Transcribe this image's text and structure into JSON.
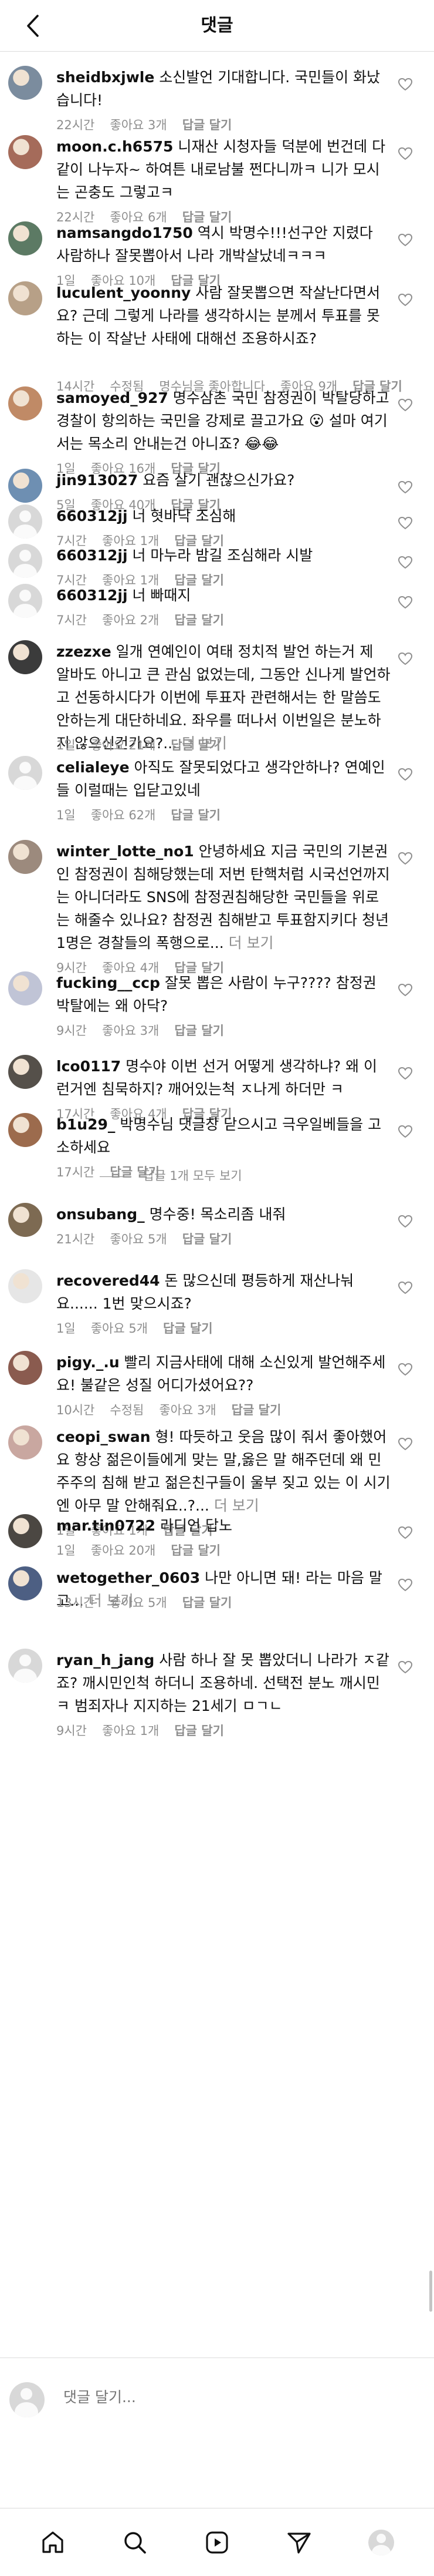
{
  "header": {
    "title": "댓글",
    "back_icon": "back-arrow-icon"
  },
  "colors": {
    "text": "#111111",
    "muted": "#8e8e8e",
    "divider": "#dbdbdb",
    "background": "#ffffff"
  },
  "comments": [
    {
      "username": "sheidbxjwle",
      "text": "소신발언 기대합니다. 국민들이 화났습니다!",
      "time": "22시간",
      "likes": "좋아요 3개",
      "reply": "답글 달기",
      "avatar": "photo"
    },
    {
      "username": "moon.c.h6575",
      "text": "니재산 시청자들 덕분에 번건데 다같이 나누자~ 하여튼 내로남불 쩐다니까ㅋ 니가 모시는 곤충도 그렇고ㅋ",
      "time": "22시간",
      "likes": "좋아요 6개",
      "reply": "답글 달기",
      "avatar": "photo"
    },
    {
      "username": "namsangdo1750",
      "text": "역시 박명수!!!선구안 지렸다 사람하나 잘못뽑아서 나라 개박살났네ㅋㅋㅋ",
      "time": "1일",
      "likes": "좋아요 10개",
      "reply": "답글 달기",
      "avatar": "photo"
    },
    {
      "username": "luculent_yoonny",
      "text": "사람 잘못뽑으면 작살난다면서요? 근데 그렇게 나라를 생각하시는 분께서 투표를 못하는 이 작살난 사태에 대해선 조용하시죠?",
      "time": "14시간",
      "edited": "수정됨",
      "likes": "명수님을 좋아합니다",
      "likes2": "좋아요 9개",
      "reply": "답글 달기",
      "avatar": "photo"
    },
    {
      "username": "samoyed_927",
      "text": "명수삼촌 국민 참정권이 박탈당하고 경찰이 항의하는 국민을 강제로 끌고가요 😮 설마 여기서는 목소리 안내는건 아니죠? 😂😂",
      "time": "1일",
      "likes": "좋아요 16개",
      "reply": "답글 달기",
      "avatar": "photo"
    },
    {
      "username": "jin913027",
      "text": "요즘 살기 괜찮으신가요?",
      "time": "5일",
      "likes": "좋아요 40개",
      "reply": "답글 달기",
      "avatar": "photo"
    },
    {
      "username": "660312jj",
      "text": "너 혓바닥 조심해",
      "time": "7시간",
      "likes": "좋아요 1개",
      "reply": "답글 달기",
      "avatar": "default"
    },
    {
      "username": "660312jj",
      "text": "너 마누라 밤길 조심해라 시발",
      "time": "7시간",
      "likes": "좋아요 1개",
      "reply": "답글 달기",
      "avatar": "default"
    },
    {
      "username": "660312jj",
      "text": "너 빠때지",
      "time": "7시간",
      "likes": "좋아요 2개",
      "reply": "답글 달기",
      "avatar": "default"
    },
    {
      "username": "zzezxe",
      "text": "일개 연예인이 여태 정치적 발언 하는거 제 알바도 아니고 큰 관심 없었는데, 그동안 신나게 발언하고 선동하시다가 이번에 투표자 관련해서는 한 말씀도 안하는게 대단하네요. 좌우를 떠나서 이번일은 분노하지 않으신건가요?...",
      "more": "더 보기",
      "time": "1일",
      "likes": "좋아요 21개",
      "reply": "답글 달기",
      "avatar": "photo"
    },
    {
      "username": "celialeye",
      "text": "아직도 잘못되었다고 생각안하나? 연예인들 이럴때는 입닫고있네",
      "time": "1일",
      "likes": "좋아요 62개",
      "reply": "답글 달기",
      "avatar": "default"
    },
    {
      "username": "winter_lotte_no1",
      "text": "안녕하세요 지금 국민의 기본권인 참정권이 침해당했는데 저번 탄핵처럼 시국선언까지는 아니더라도 SNS에 참정권침해당한 국민들을 위로는 해줄수 있나요? 참정권 침해받고 투표함지키다 청년1명은 경찰들의 폭행으로...",
      "more": "더 보기",
      "time": "9시간",
      "likes": "좋아요 4개",
      "reply": "답글 달기",
      "avatar": "photo"
    },
    {
      "username": "fucking__ccp",
      "text": "잘못 뽑은 사람이 누구???? 참정권 박탈에는 왜 아닥?",
      "time": "9시간",
      "likes": "좋아요 3개",
      "reply": "답글 달기",
      "avatar": "photo"
    },
    {
      "username": "lco0117",
      "text": "명수야 이번 선거 어떻게 생각하냐? 왜 이런거엔 침묵하지? 깨어있는척 ㅈ나게 하더만 ㅋ",
      "time": "17시간",
      "likes": "좋아요 4개",
      "reply": "답글 달기",
      "avatar": "photo"
    },
    {
      "username": "b1u29_",
      "text": "박명수님 댓글창 닫으시고 극우일베들을 고소하세요",
      "time": "17시간",
      "likes": "",
      "reply": "답글 달기",
      "avatar": "photo"
    },
    {
      "username": "onsubang_",
      "text": "명수중! 목소리좀 내줘",
      "time": "21시간",
      "likes": "좋아요 5개",
      "reply": "답글 달기",
      "avatar": "photo"
    },
    {
      "username": "recovered44",
      "text": "돈 많으신데 평등하게 재산나눠요...... 1번 맞으시죠?",
      "time": "1일",
      "likes": "좋아요 5개",
      "reply": "답글 달기",
      "avatar": "photo"
    },
    {
      "username": "pigy._.u",
      "text": "빨리 지금사태에 대해 소신있게 발언해주세요! 불같은 성질 어디가셨어요??",
      "time": "10시간",
      "edited": "수정됨",
      "likes": "좋아요 3개",
      "reply": "답글 달기",
      "avatar": "photo"
    },
    {
      "username": "ceopi_swan",
      "text": "형! 따듯하고 웃음 많이 줘서 좋아했어요 항상 젊은이들에게 맞는 말,옳은 말 해주던데 왜 민주주의 침해 받고 젊은친구들이 울부 짖고 있는 이 시기엔 아무 말 안해줘요..?...",
      "more": "더 보기",
      "time": "1일",
      "likes": "좋아요 1개",
      "reply": "답글 달기",
      "avatar": "photo"
    },
    {
      "username": "mar.tin0722",
      "text": "라디언 답노",
      "time": "1일",
      "likes": "좋아요 20개",
      "reply": "답글 달기",
      "avatar": "photo"
    },
    {
      "username": "wetogether_0603",
      "text": "나만 아니면 돼! 라는 마음 말고...",
      "more": "더 보기",
      "time": "13시간",
      "likes": "좋아요 5개",
      "reply": "답글 달기",
      "avatar": "photo"
    },
    {
      "username": "ryan_h_jang",
      "text": "사람 하나 잘 못 뽑았더니 나라가 ㅈ같죠? 깨시민인척 하더니 조용하네. 선택전 분노 깨시민 ㅋ 범죄자나 지지하는 21세기 ㅁㄱㄴ",
      "time": "9시간",
      "likes": "좋아요 1개",
      "reply": "답글 달기",
      "avatar": "default"
    }
  ],
  "hidden_replies": "답글 1개 모두 보기",
  "input": {
    "placeholder": "댓글 달기..."
  },
  "tabs": [
    "home-icon",
    "search-icon",
    "reels-icon",
    "send-icon",
    "profile-icon"
  ]
}
